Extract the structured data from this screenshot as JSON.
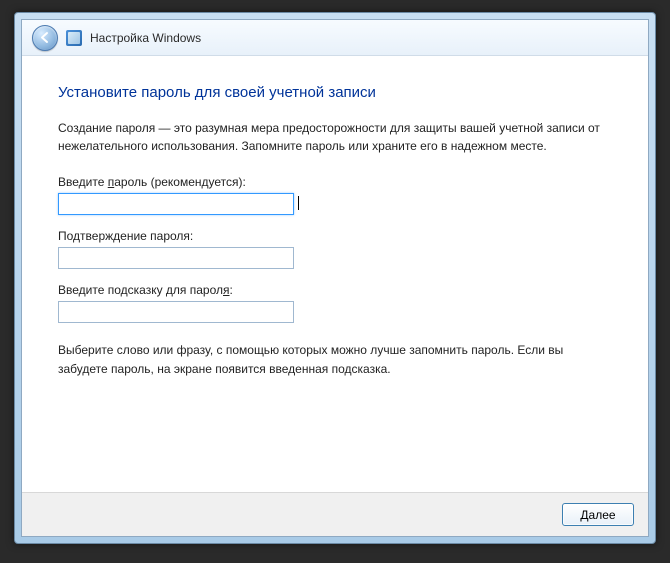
{
  "header": {
    "title": "Настройка Windows"
  },
  "heading": "Установите пароль для своей учетной записи",
  "intro": "Создание пароля — это разумная мера предосторожности для защиты вашей учетной записи от нежелательного использования. Запомните пароль или храните его в надежном месте.",
  "fields": {
    "password": {
      "label_pre": "Введите ",
      "label_u": "п",
      "label_post": "ароль (рекомендуется):",
      "value": ""
    },
    "confirm": {
      "label": "Подтверждение пароля:",
      "value": ""
    },
    "hint": {
      "label_pre": "Введите подсказку для парол",
      "label_u": "я",
      "label_post": ":",
      "value": ""
    }
  },
  "hint_text": "Выберите слово или фразу, с помощью которых можно лучше запомнить пароль. Если вы забудете пароль, на экране появится введенная подсказка.",
  "footer": {
    "next": "Далее"
  }
}
